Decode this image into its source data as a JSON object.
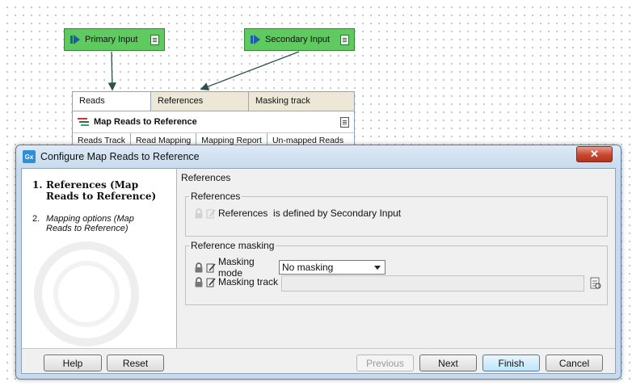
{
  "workflow": {
    "primary_input_label": "Primary Input",
    "secondary_input_label": "Secondary Input",
    "tool": {
      "tabs": [
        "Reads",
        "References",
        "Masking track"
      ],
      "title": "Map Reads to Reference",
      "outputs": [
        "Reads Track",
        "Read Mapping",
        "Mapping Report",
        "Un-mapped Reads"
      ]
    }
  },
  "dialog": {
    "app_icon_text": "Gx",
    "title": "Configure Map Reads to Reference",
    "close_glyph": "✕",
    "steps": [
      {
        "num": "1.",
        "label": "References (Map Reads to Reference)"
      },
      {
        "num": "2.",
        "label": "Mapping options (Map Reads to Reference)"
      }
    ],
    "section_title": "References",
    "references_group": {
      "legend": "References",
      "text": "References  is defined by Secondary Input"
    },
    "masking_group": {
      "legend": "Reference masking",
      "mode_label": "Masking mode",
      "mode_value": "No masking",
      "track_label": "Masking track"
    },
    "buttons": {
      "help": "Help",
      "reset": "Reset",
      "previous": "Previous",
      "next": "Next",
      "finish": "Finish",
      "cancel": "Cancel"
    }
  }
}
